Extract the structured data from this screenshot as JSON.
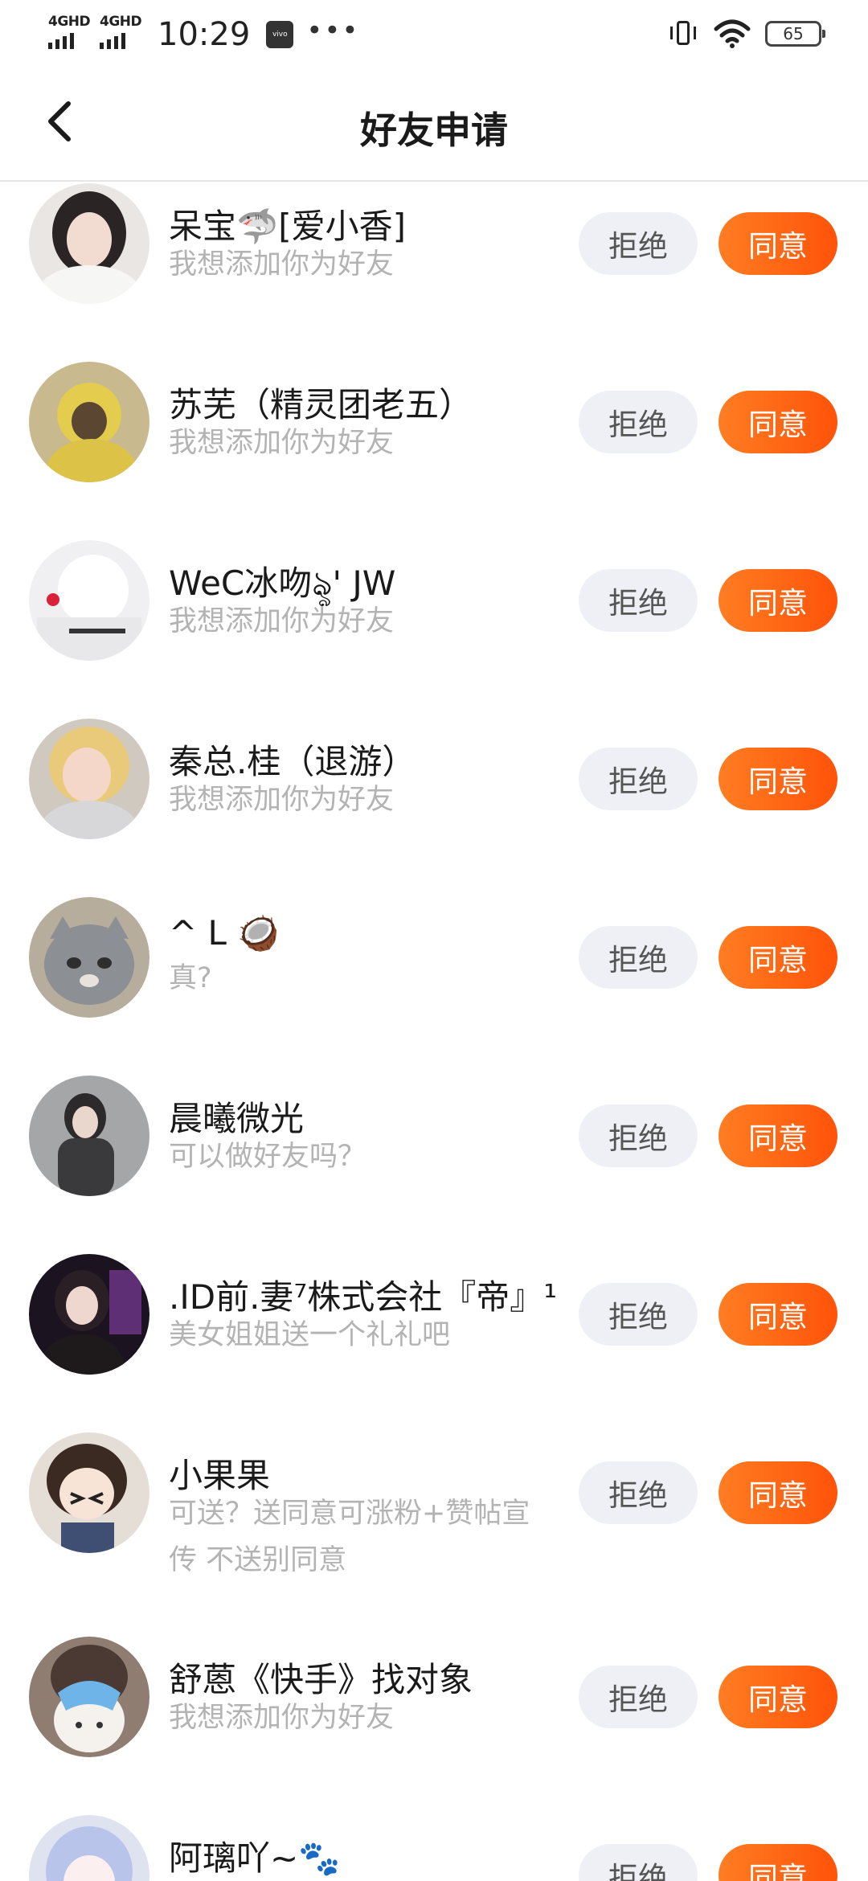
{
  "status_bar": {
    "net1": "4GHD",
    "net2": "4GHD",
    "time": "10:29",
    "app_badge": "vivo",
    "more": "•••",
    "battery": "65"
  },
  "header": {
    "title": "好友申请"
  },
  "buttons": {
    "reject": "拒绝",
    "accept": "同意"
  },
  "requests": [
    {
      "name": "呆宝🦈[爱小香]",
      "message": "我想添加你为好友"
    },
    {
      "name": "苏芜（精灵团老五）",
      "message": "我想添加你为好友"
    },
    {
      "name": "WeC冰吻ৡ' JW",
      "message": "我想添加你为好友"
    },
    {
      "name": "秦总.桂（退游）",
      "message": "我想添加你为好友"
    },
    {
      "name": "^ L 🥥",
      "message": "真?"
    },
    {
      "name": "晨曦微光",
      "message": "可以做好友吗？"
    },
    {
      "name": ".ID前.妻⁷株式会社『帝』¹",
      "message": "美女姐姐送一个礼礼吧"
    },
    {
      "name": "小果果",
      "message": "可送？送同意可涨粉+赞帖宣传 不送别同意"
    },
    {
      "name": "舒蒽《快手》找对象",
      "message": "我想添加你为好友"
    },
    {
      "name": "阿璃吖~🐾",
      "message": ""
    }
  ],
  "colors": {
    "accent": "#ff5c0f",
    "reject_bg": "#eef0f5",
    "secondary_text": "#b3b3b3"
  },
  "icons": {
    "back": "chevron-left-icon",
    "vibrate": "vibrate-icon",
    "wifi": "wifi-icon",
    "battery": "battery-icon"
  }
}
